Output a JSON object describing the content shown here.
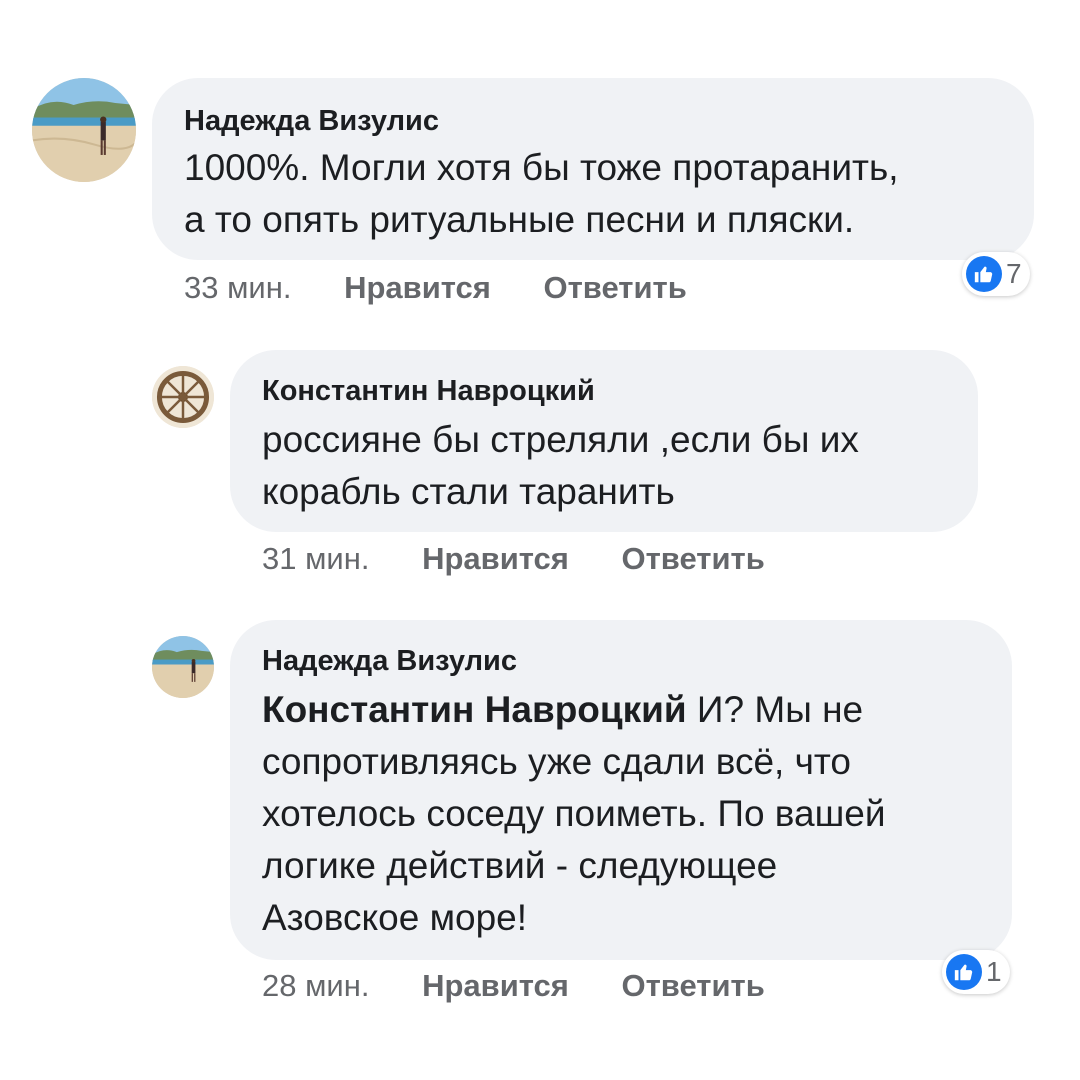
{
  "comments": [
    {
      "author": "Надежда Визулис",
      "mention": "",
      "text_lines": [
        "1000%. Могли хотя бы тоже протаранить,",
        "а то опять ритуальные песни и пляски."
      ],
      "time": "33 мин.",
      "like_label": "Нравится",
      "reply_label": "Ответить",
      "reactions": "7",
      "avatar_icon": "beach-photo"
    },
    {
      "author": "Константин Навроцкий",
      "mention": "",
      "text_lines": [
        "россияне бы стреляли ,если бы их",
        "корабль стали таранить"
      ],
      "time": "31 мин.",
      "like_label": "Нравится",
      "reply_label": "Ответить",
      "avatar_icon": "wagon-wheel-photo"
    },
    {
      "author": "Надежда Визулис",
      "mention": "Константин Навроцкий",
      "text_first_rest": " И? Мы не",
      "text_lines": [
        "сопротивляясь уже сдали всё, что",
        "хотелось соседу поиметь. По вашей",
        "логике действий - следующее",
        "Азовское море!"
      ],
      "time": "28 мин.",
      "like_label": "Нравится",
      "reply_label": "Ответить",
      "reactions": "1",
      "avatar_icon": "beach-photo"
    }
  ],
  "colors": {
    "bubble": "#f0f2f5",
    "like_blue": "#1877f2",
    "meta_grey": "#65676b"
  }
}
